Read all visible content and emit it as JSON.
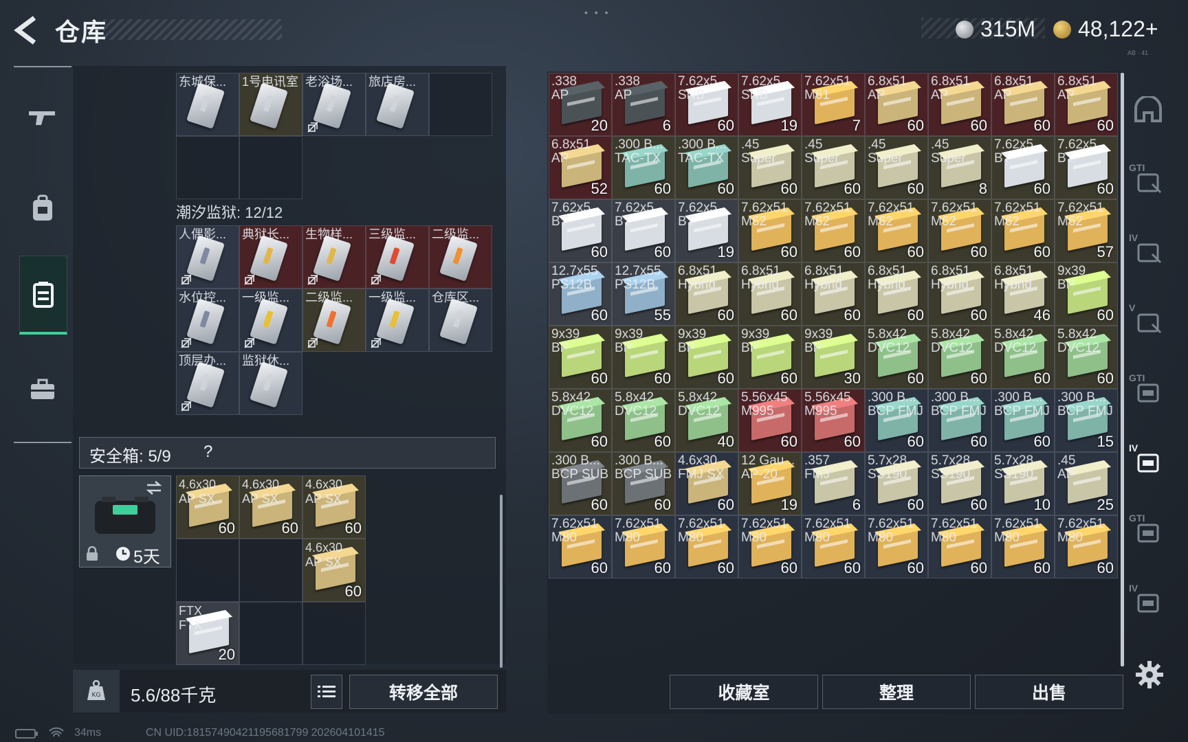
{
  "header": {
    "title": "仓库",
    "currency1": "315M",
    "currency2": "48,122+",
    "top_right_tiny": "AB · 41"
  },
  "stash": {
    "group1": [
      {
        "label": "东城保...",
        "empty": false,
        "bg": "#2b3341",
        "strip": "#cfd4da",
        "bind": false
      },
      {
        "label": "1号电讯室",
        "empty": false,
        "bg": "#3b3a2c",
        "strip": "#cfd4da",
        "bind": false
      },
      {
        "label": "老浴场...",
        "empty": false,
        "bg": "#2b3341",
        "strip": "#cfd4da",
        "bind": true
      },
      {
        "label": "旅店房...",
        "empty": false,
        "bg": "#2b3341",
        "strip": "#cfd4da",
        "bind": false
      },
      {
        "label": "",
        "empty": true
      },
      {
        "label": "",
        "empty": true
      },
      {
        "label": "",
        "empty": true
      }
    ],
    "section_title": "潮汐监狱: 12/12",
    "group2": [
      {
        "label": "人偶影...",
        "empty": false,
        "bg": "#2f3645",
        "strip": "#7f8aa0",
        "bind": true
      },
      {
        "label": "典狱长...",
        "empty": false,
        "bg": "#4a2226",
        "strip": "#e2b64a",
        "bind": true
      },
      {
        "label": "生物样...",
        "empty": false,
        "bg": "#4a2226",
        "strip": "#e2b64a",
        "bind": true
      },
      {
        "label": "三级监...",
        "empty": false,
        "bg": "#4a2226",
        "strip": "#e04a2f",
        "bind": true
      },
      {
        "label": "二级监...",
        "empty": false,
        "bg": "#4a2226",
        "strip": "#f09030",
        "bind": false
      },
      {
        "label": "水位控...",
        "empty": false,
        "bg": "#2b3341",
        "strip": "#7f8aa0",
        "bind": true
      },
      {
        "label": "一级监...",
        "empty": false,
        "bg": "#2b3341",
        "strip": "#e8c030",
        "bind": true
      },
      {
        "label": "二级监...",
        "empty": false,
        "bg": "#3b3a2c",
        "strip": "#f07030",
        "bind": true
      },
      {
        "label": "一级监...",
        "empty": false,
        "bg": "#2b3341",
        "strip": "#e8c030",
        "bind": true
      },
      {
        "label": "仓库区...",
        "empty": false,
        "bg": "#2b3341",
        "strip": "#cfd4da",
        "bind": false
      },
      {
        "label": "顶层办...",
        "empty": false,
        "bg": "#2b3341",
        "strip": "#cfd4da",
        "bind": true
      },
      {
        "label": "监狱休...",
        "empty": false,
        "bg": "#2b3341",
        "strip": "#cfd4da",
        "bind": false
      }
    ]
  },
  "safe_box": {
    "label": "安全箱: 5/9",
    "help": "?",
    "timer": "5天",
    "items": [
      {
        "label": "4.6x30\nAP SX",
        "count": "60",
        "col": 1,
        "row": 1,
        "bg": "#3b3a2c",
        "box": "#cbb47a"
      },
      {
        "label": "4.6x30\nAP SX",
        "count": "60",
        "col": 2,
        "row": 1,
        "bg": "#3b3a2c",
        "box": "#cbb47a"
      },
      {
        "label": "4.6x30\nAP SX",
        "count": "60",
        "col": 3,
        "row": 1,
        "bg": "#3b3a2c",
        "box": "#cbb47a"
      },
      {
        "label": "4.6x30\nAP SX",
        "count": "60",
        "col": 3,
        "row": 2,
        "bg": "#3b3a2c",
        "box": "#cbb47a"
      },
      {
        "label": "FTX\nFTX",
        "count": "20",
        "col": 1,
        "row": 3,
        "bg": "#3a3e46",
        "box": "#d8dde3"
      }
    ]
  },
  "footer": {
    "weight": "5.6/88千克",
    "transfer_all": "转移全部"
  },
  "inventory": {
    "items": [
      {
        "label": ".338\nAP",
        "count": "20",
        "bg": "#4a2226",
        "box": "#4a5256"
      },
      {
        "label": ".338\nAP",
        "count": "6",
        "bg": "#4a2226",
        "box": "#4a5256"
      },
      {
        "label": "7.62x5...\nSNB",
        "count": "60",
        "bg": "#4a2226",
        "box": "#d8dde3"
      },
      {
        "label": "7.62x5...\nSNB",
        "count": "19",
        "bg": "#4a2226",
        "box": "#d8dde3"
      },
      {
        "label": "7.62x51\nM61",
        "count": "7",
        "bg": "#4a2226",
        "box": "#e0b25a"
      },
      {
        "label": "6.8x51\nAP",
        "count": "60",
        "bg": "#4a2226",
        "box": "#cbb47a"
      },
      {
        "label": "6.8x51\nAP",
        "count": "60",
        "bg": "#4a2226",
        "box": "#cbb47a"
      },
      {
        "label": "6.8x51\nAP",
        "count": "60",
        "bg": "#4a2226",
        "box": "#cbb47a"
      },
      {
        "label": "6.8x51\nAP",
        "count": "60",
        "bg": "#4a2226",
        "box": "#cbb47a"
      },
      {
        "label": "6.8x51\nAP",
        "count": "52",
        "bg": "#4a2226",
        "box": "#cbb47a"
      },
      {
        "label": ".300 B...\nTAC-TX",
        "count": "60",
        "bg": "#3b3a2c",
        "box": "#7fb3a8"
      },
      {
        "label": ".300 B...\nTAC-TX",
        "count": "60",
        "bg": "#3b3a2c",
        "box": "#7fb3a8"
      },
      {
        "label": ".45\nSuper",
        "count": "60",
        "bg": "#3b3a2c",
        "box": "#c9c6a8"
      },
      {
        "label": ".45\nSuper",
        "count": "60",
        "bg": "#3b3a2c",
        "box": "#c9c6a8"
      },
      {
        "label": ".45\nSuper",
        "count": "60",
        "bg": "#3b3a2c",
        "box": "#c9c6a8"
      },
      {
        "label": ".45\nSuper",
        "count": "8",
        "bg": "#3b3a2c",
        "box": "#c9c6a8"
      },
      {
        "label": "7.62x5...\nBT",
        "count": "60",
        "bg": "#3b3a2c",
        "box": "#d8dde3"
      },
      {
        "label": "7.62x5...\nBT",
        "count": "60",
        "bg": "#3b3a2c",
        "box": "#d8dde3"
      },
      {
        "label": "7.62x5...\nBT",
        "count": "60",
        "bg": "#3a3e46",
        "box": "#d8dde3"
      },
      {
        "label": "7.62x5...\nBT",
        "count": "60",
        "bg": "#3a3e46",
        "box": "#d8dde3"
      },
      {
        "label": "7.62x5...\nBT",
        "count": "19",
        "bg": "#3a3e46",
        "box": "#d8dde3"
      },
      {
        "label": "7.62x51\nM62",
        "count": "60",
        "bg": "#3b3a2c",
        "box": "#e0b25a"
      },
      {
        "label": "7.62x51\nM62",
        "count": "60",
        "bg": "#3b3a2c",
        "box": "#e0b25a"
      },
      {
        "label": "7.62x51\nM62",
        "count": "60",
        "bg": "#3b3a2c",
        "box": "#e0b25a"
      },
      {
        "label": "7.62x51\nM62",
        "count": "60",
        "bg": "#3b3a2c",
        "box": "#e0b25a"
      },
      {
        "label": "7.62x51\nM62",
        "count": "60",
        "bg": "#3b3a2c",
        "box": "#e0b25a"
      },
      {
        "label": "7.62x51\nM62",
        "count": "57",
        "bg": "#3b3a2c",
        "box": "#e0b25a"
      },
      {
        "label": "12.7x55\nPS12B",
        "count": "60",
        "bg": "#3a3e46",
        "box": "#8fb0c8"
      },
      {
        "label": "12.7x55\nPS12B",
        "count": "55",
        "bg": "#3a3e46",
        "box": "#8fb0c8"
      },
      {
        "label": "6.8x51\nHybrid",
        "count": "60",
        "bg": "#3b3a2c",
        "box": "#c9c6a8"
      },
      {
        "label": "6.8x51\nHybrid",
        "count": "60",
        "bg": "#3b3a2c",
        "box": "#c9c6a8"
      },
      {
        "label": "6.8x51\nHybrid",
        "count": "60",
        "bg": "#3b3a2c",
        "box": "#c9c6a8"
      },
      {
        "label": "6.8x51\nHybrid",
        "count": "60",
        "bg": "#3b3a2c",
        "box": "#c9c6a8"
      },
      {
        "label": "6.8x51\nHybrid",
        "count": "60",
        "bg": "#3b3a2c",
        "box": "#c9c6a8"
      },
      {
        "label": "6.8x51\nHybrid",
        "count": "46",
        "bg": "#3b3a2c",
        "box": "#c9c6a8"
      },
      {
        "label": "9x39\nBP",
        "count": "60",
        "bg": "#3b3a2c",
        "box": "#b9d67a"
      },
      {
        "label": "9x39\nBP",
        "count": "60",
        "bg": "#3b3a2c",
        "box": "#b9d67a"
      },
      {
        "label": "9x39\nBP",
        "count": "60",
        "bg": "#3b3a2c",
        "box": "#b9d67a"
      },
      {
        "label": "9x39\nBP",
        "count": "60",
        "bg": "#3b3a2c",
        "box": "#b9d67a"
      },
      {
        "label": "9x39\nBP",
        "count": "60",
        "bg": "#3b3a2c",
        "box": "#b9d67a"
      },
      {
        "label": "9x39\nBP",
        "count": "30",
        "bg": "#3b3a2c",
        "box": "#b9d67a"
      },
      {
        "label": "5.8x42\nDVC12",
        "count": "60",
        "bg": "#3b3a2c",
        "box": "#8fc08a"
      },
      {
        "label": "5.8x42\nDVC12",
        "count": "60",
        "bg": "#3b3a2c",
        "box": "#8fc08a"
      },
      {
        "label": "5.8x42\nDVC12",
        "count": "60",
        "bg": "#3b3a2c",
        "box": "#8fc08a"
      },
      {
        "label": "5.8x42\nDVC12",
        "count": "60",
        "bg": "#3b3a2c",
        "box": "#8fc08a"
      },
      {
        "label": "5.8x42\nDVC12",
        "count": "60",
        "bg": "#3b3a2c",
        "box": "#8fc08a"
      },
      {
        "label": "5.8x42\nDVC12",
        "count": "60",
        "bg": "#3b3a2c",
        "box": "#8fc08a"
      },
      {
        "label": "5.8x42\nDVC12",
        "count": "40",
        "bg": "#3b3a2c",
        "box": "#8fc08a"
      },
      {
        "label": "5.56x45\nM995",
        "count": "60",
        "bg": "#4a2226",
        "box": "#c86a6a"
      },
      {
        "label": "5.56x45\nM995",
        "count": "60",
        "bg": "#4a2226",
        "box": "#c86a6a"
      },
      {
        "label": ".300 B...\nBCP FMJ",
        "count": "60",
        "bg": "#2b3341",
        "box": "#7fb3a8"
      },
      {
        "label": ".300 B...\nBCP FMJ",
        "count": "60",
        "bg": "#2b3341",
        "box": "#7fb3a8"
      },
      {
        "label": ".300 B...\nBCP FMJ",
        "count": "60",
        "bg": "#2b3341",
        "box": "#7fb3a8"
      },
      {
        "label": ".300 B...\nBCP FMJ",
        "count": "15",
        "bg": "#2b3341",
        "box": "#7fb3a8"
      },
      {
        "label": ".300 B...\nBCP SUB",
        "count": "60",
        "bg": "#3b3a2c",
        "box": "#6c7176"
      },
      {
        "label": ".300 B...\nBCP SUB",
        "count": "60",
        "bg": "#3b3a2c",
        "box": "#6c7176"
      },
      {
        "label": "4.6x30\nFMJ SX",
        "count": "60",
        "bg": "#2b3341",
        "box": "#cbb47a"
      },
      {
        "label": "12 Gau...\nAP-20",
        "count": "19",
        "bg": "#3b3a2c",
        "box": "#e0b25a"
      },
      {
        "label": ".357\nFMJ",
        "count": "6",
        "bg": "#2b3341",
        "box": "#c9c6a8"
      },
      {
        "label": "5.7x28\nSS190",
        "count": "60",
        "bg": "#2b3341",
        "box": "#c9c6a8"
      },
      {
        "label": "5.7x28\nSS190",
        "count": "60",
        "bg": "#2b3341",
        "box": "#c9c6a8"
      },
      {
        "label": "5.7x28\nSS190",
        "count": "10",
        "bg": "#2b3341",
        "box": "#c9c6a8"
      },
      {
        "label": ".45\nAP",
        "count": "25",
        "bg": "#2b3341",
        "box": "#c9c6a8"
      },
      {
        "label": "7.62x51\nM80",
        "count": "60",
        "bg": "#2b3341",
        "box": "#e0b25a"
      },
      {
        "label": "7.62x51\nM80",
        "count": "60",
        "bg": "#2b3341",
        "box": "#e0b25a"
      },
      {
        "label": "7.62x51\nM80",
        "count": "60",
        "bg": "#2b3341",
        "box": "#e0b25a"
      },
      {
        "label": "7.62x51\nM80",
        "count": "60",
        "bg": "#2b3341",
        "box": "#e0b25a"
      },
      {
        "label": "7.62x51\nM80",
        "count": "60",
        "bg": "#2b3341",
        "box": "#e0b25a"
      },
      {
        "label": "7.62x51\nM80",
        "count": "60",
        "bg": "#2b3341",
        "box": "#e0b25a"
      },
      {
        "label": "7.62x51\nM80",
        "count": "60",
        "bg": "#2b3341",
        "box": "#e0b25a"
      },
      {
        "label": "7.62x51\nM80",
        "count": "60",
        "bg": "#2b3341",
        "box": "#e0b25a"
      },
      {
        "label": "7.62x51\nM80",
        "count": "60",
        "bg": "#2b3341",
        "box": "#e0b25a"
      }
    ]
  },
  "actions": {
    "collection": "收藏室",
    "organize": "整理",
    "sell": "出售"
  },
  "right_tabs": [
    {
      "label": "",
      "icon": "helmet-icon",
      "active": false
    },
    {
      "label": "GTI",
      "icon": "vest-icon",
      "active": false
    },
    {
      "label": "IV",
      "icon": "vest-icon",
      "active": false
    },
    {
      "label": "V",
      "icon": "vest-icon",
      "active": false
    },
    {
      "label": "GTI",
      "icon": "backpack-icon",
      "active": false
    },
    {
      "label": "IV",
      "icon": "backpack-icon",
      "active": true
    },
    {
      "label": "GTI",
      "icon": "backpack-icon",
      "active": false
    },
    {
      "label": "IV",
      "icon": "backpack-icon",
      "active": false
    }
  ],
  "status": {
    "ping": "34ms",
    "uid": "CN UID:18157490421195681799 202604101415"
  },
  "colors": {
    "accent": "#3fcf9a",
    "red_cell": "#4a2226",
    "gold_cell": "#3b3a2c",
    "blue_cell": "#2b3341"
  }
}
